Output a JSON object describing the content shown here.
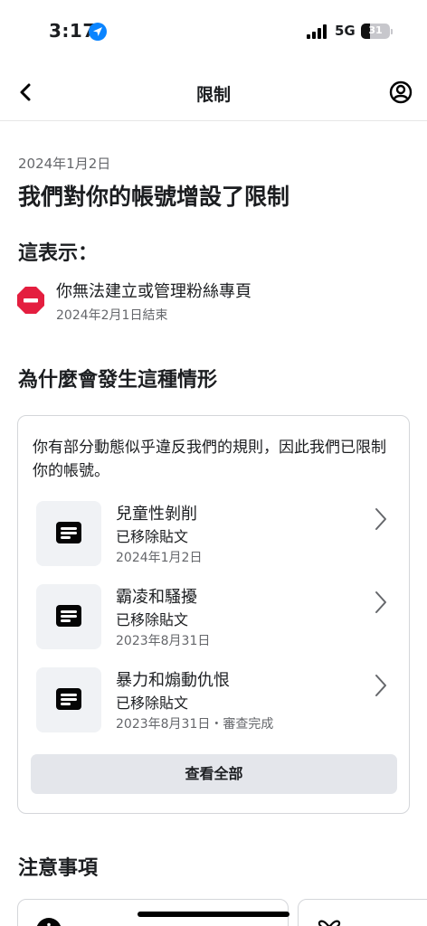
{
  "status_bar": {
    "time": "3:17",
    "network": "5G",
    "battery": "31",
    "battery_level": 0.31
  },
  "nav": {
    "title": "限制",
    "back_icon": "chevron-left-icon",
    "profile_icon": "account-circle-icon"
  },
  "restriction": {
    "date": "2024年1月2日",
    "headline": "我們對你的帳號增設了限制",
    "meaning_heading": "這表示：",
    "item_text": "你無法建立或管理粉絲專頁",
    "item_end": "2024年2月1日結束",
    "item_icon": "stop-icon"
  },
  "why": {
    "heading": "為什麼會發生這種情形",
    "description": "你有部分動態似乎違反我們的規則，因此我們已限制你的帳號。",
    "violations": [
      {
        "title": "兒童性剝削",
        "status": "已移除貼文",
        "date": "2024年1月2日",
        "icon": "post-icon"
      },
      {
        "title": "霸凌和騷擾",
        "status": "已移除貼文",
        "date": "2023年8月31日",
        "icon": "post-icon"
      },
      {
        "title": "暴力和煽動仇恨",
        "status": "已移除貼文",
        "date": "2023年8月31日・審查完成",
        "icon": "post-icon"
      }
    ],
    "see_all_label": "查看全部"
  },
  "notes": {
    "heading": "注意事項"
  },
  "colors": {
    "accent_blue": "#0a84ff",
    "stop_red": "#e41e3f",
    "muted_text": "#65676b",
    "button_bg": "#e4e6eb"
  }
}
